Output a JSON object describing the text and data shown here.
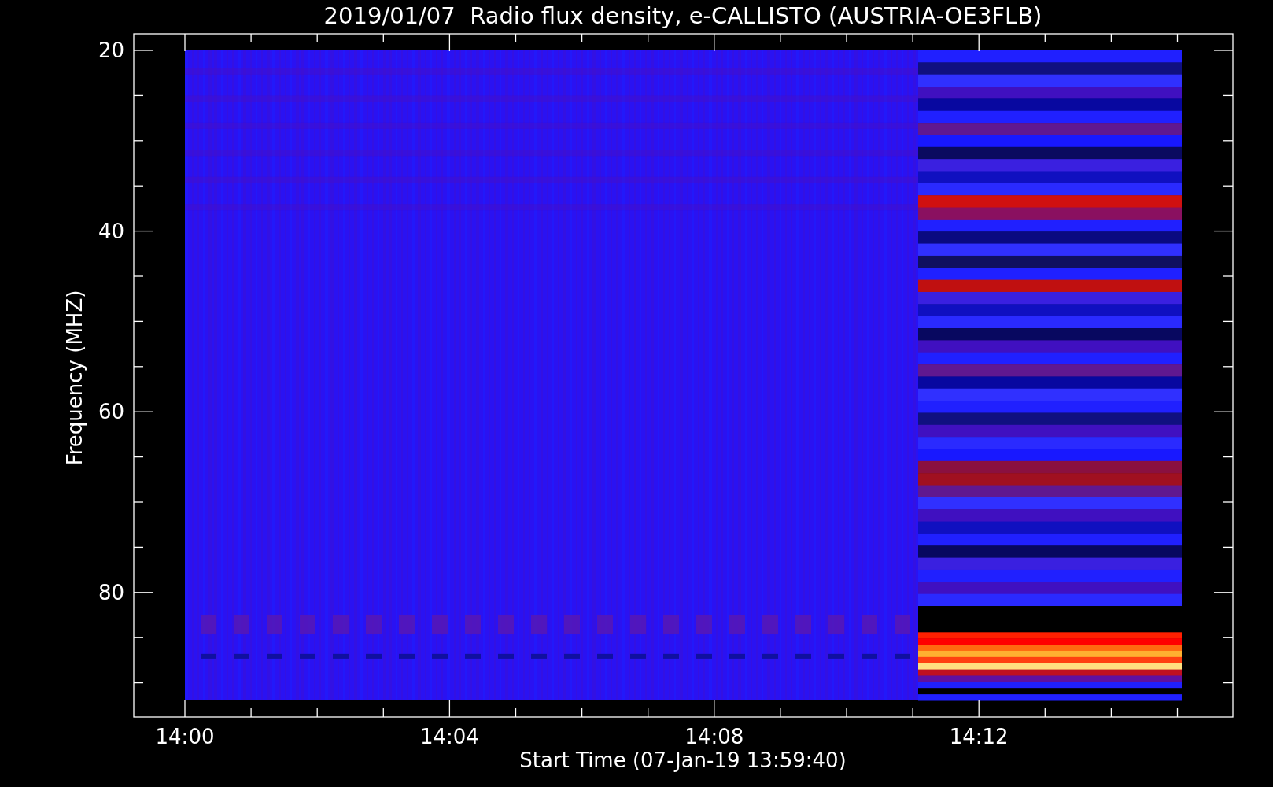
{
  "plot": {
    "title": "2019/01/07  Radio flux density, e-CALLISTO (AUSTRIA-OE3FLB)",
    "ylabel": "Frequency (MHZ)",
    "xlabel": "Start Time (07-Jan-19 13:59:40)",
    "y_tick_labels": [
      "20",
      "40",
      "60",
      "80"
    ],
    "x_tick_labels": [
      "14:00",
      "14:04",
      "14:08",
      "14:12"
    ]
  }
}
